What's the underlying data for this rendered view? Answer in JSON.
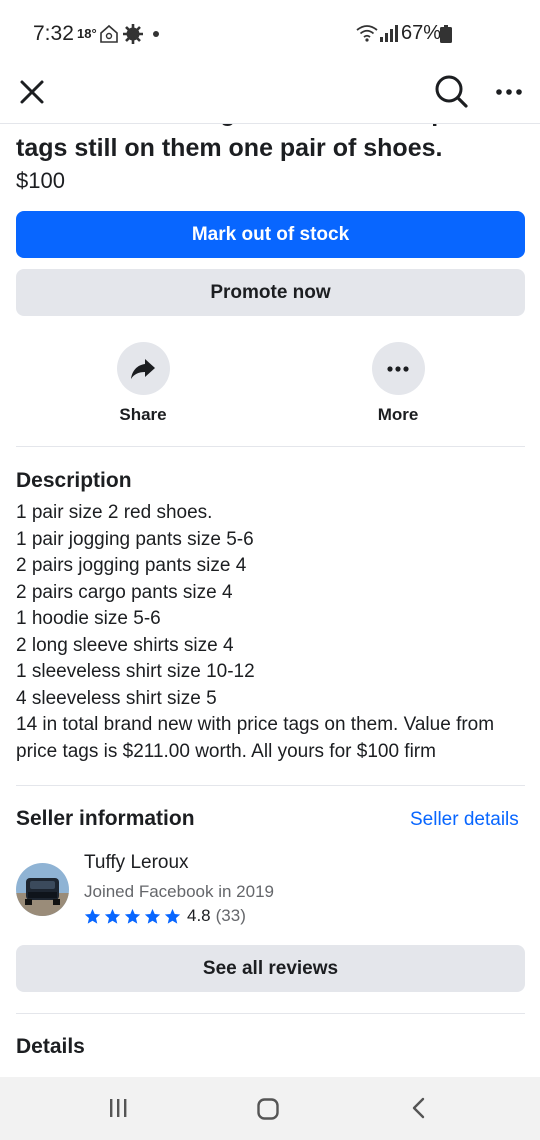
{
  "status_bar": {
    "time": "7:32",
    "temperature": "18°",
    "battery": "67%"
  },
  "listing": {
    "title": "Childrens clothing brand new with price tags still on them one pair of shoes.",
    "price": "$100"
  },
  "buttons": {
    "mark_out_of_stock": "Mark out of stock",
    "promote_now": "Promote now",
    "see_all_reviews": "See all reviews"
  },
  "actions": {
    "share": "Share",
    "more": "More"
  },
  "description": {
    "heading": "Description",
    "lines": [
      "1 pair size 2 red shoes.",
      "1 pair jogging pants size 5-6",
      "2 pairs jogging pants size 4",
      "2 pairs cargo pants size 4",
      "1 hoodie size 5-6",
      "2 long sleeve shirts size 4",
      "1 sleeveless shirt size 10-12",
      "4 sleeveless shirt size 5",
      "14 in total brand new with price tags on them. Value from price tags is $211.00 worth. All yours for $100 firm"
    ]
  },
  "seller": {
    "heading": "Seller information",
    "details_link": "Seller details",
    "name": "Tuffy Leroux",
    "joined": "Joined Facebook in 2019",
    "rating": "4.8",
    "rating_count": "(33)",
    "stars": 5
  },
  "details": {
    "heading": "Details"
  },
  "colors": {
    "accent": "#0866ff",
    "secondary_button": "#e4e6eb",
    "muted_text": "#65676b"
  },
  "icons": {
    "close": "close-icon",
    "search": "search-icon",
    "more": "more-horizontal-icon",
    "share": "share-arrow-icon",
    "star": "star-icon"
  }
}
